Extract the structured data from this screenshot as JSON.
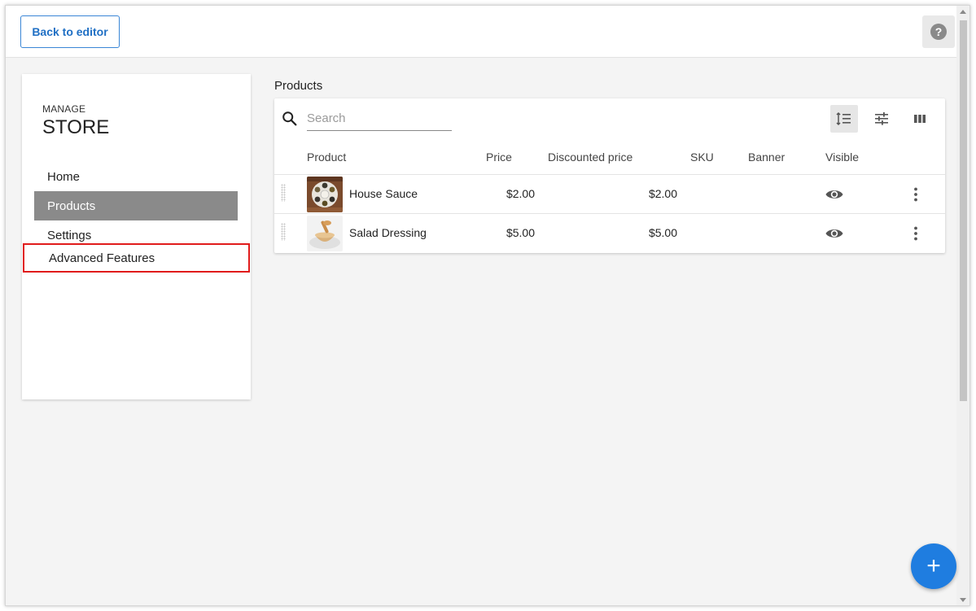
{
  "topbar": {
    "back_label": "Back to editor",
    "help_symbol": "?"
  },
  "sidebar": {
    "manage_label": "MANAGE",
    "store_label": "STORE",
    "items": [
      {
        "label": "Home"
      },
      {
        "label": "Products"
      },
      {
        "label": "Settings"
      },
      {
        "label": "Advanced Features"
      }
    ],
    "active_index": 1,
    "highlighted_index": 3
  },
  "main": {
    "title": "Products",
    "search": {
      "placeholder": "Search",
      "value": ""
    },
    "toolbar_icons": [
      "sort-icon",
      "filter-icon",
      "columns-icon"
    ],
    "columns": [
      "Product",
      "Price",
      "Discounted price",
      "SKU",
      "Banner",
      "Visible"
    ],
    "rows": [
      {
        "name": "House Sauce",
        "price": "$2.00",
        "discounted": "$2.00",
        "sku": "",
        "banner": "",
        "visible_icon": "eye-icon"
      },
      {
        "name": "Salad Dressing",
        "price": "$5.00",
        "discounted": "$5.00",
        "sku": "",
        "banner": "",
        "visible_icon": "eye-icon"
      }
    ]
  },
  "fab": {
    "symbol": "+"
  },
  "colors": {
    "accent": "#1f7de0",
    "active_nav": "#8a8a8a",
    "highlight_border": "#e01b1b"
  }
}
